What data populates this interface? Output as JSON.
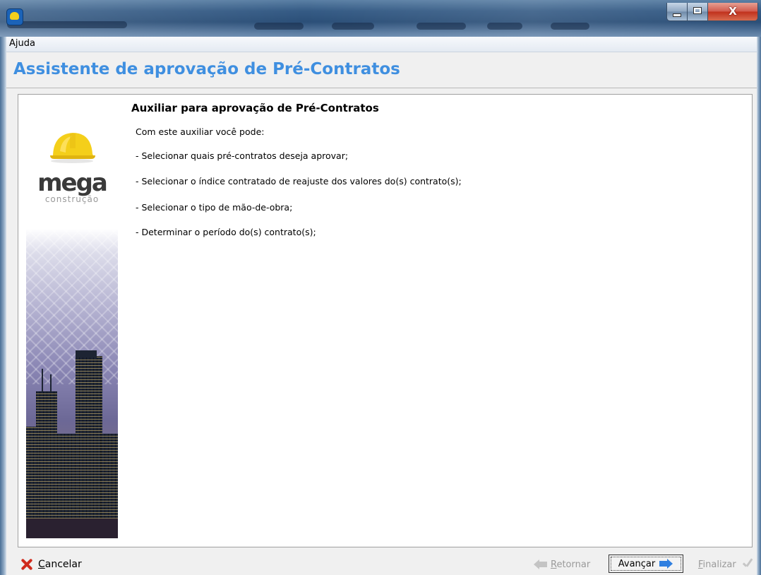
{
  "window": {
    "title": "",
    "menu": [
      {
        "label": "Ajuda"
      }
    ]
  },
  "header": {
    "title": "Assistente de aprovação de Pré-Contratos",
    "color": "#3f8fe0"
  },
  "sidebar_image": {
    "logo_text": "mega",
    "logo_subtext": "construção",
    "helmet_color": "#f4cf1a"
  },
  "content": {
    "section_title": "Auxiliar para aprovação de Pré-Contratos",
    "intro": "Com este auxiliar você pode:",
    "bullets": [
      "- Selecionar quais pré-contratos deseja aprovar;",
      "- Selecionar o índice contratado de reajuste dos valores do(s) contrato(s);",
      "- Selecionar o tipo de mão-de-obra;",
      "- Determinar o período do(s) contrato(s);"
    ]
  },
  "footer": {
    "cancel_label": "Cancelar",
    "back_label": "Retornar",
    "next_label": "Avançar",
    "finish_label": "Finalizar",
    "back_enabled": false,
    "finish_enabled": false
  },
  "icons": {
    "cancel": "x-icon",
    "back": "arrow-left-icon",
    "next": "arrow-right-icon",
    "finish": "check-icon"
  }
}
